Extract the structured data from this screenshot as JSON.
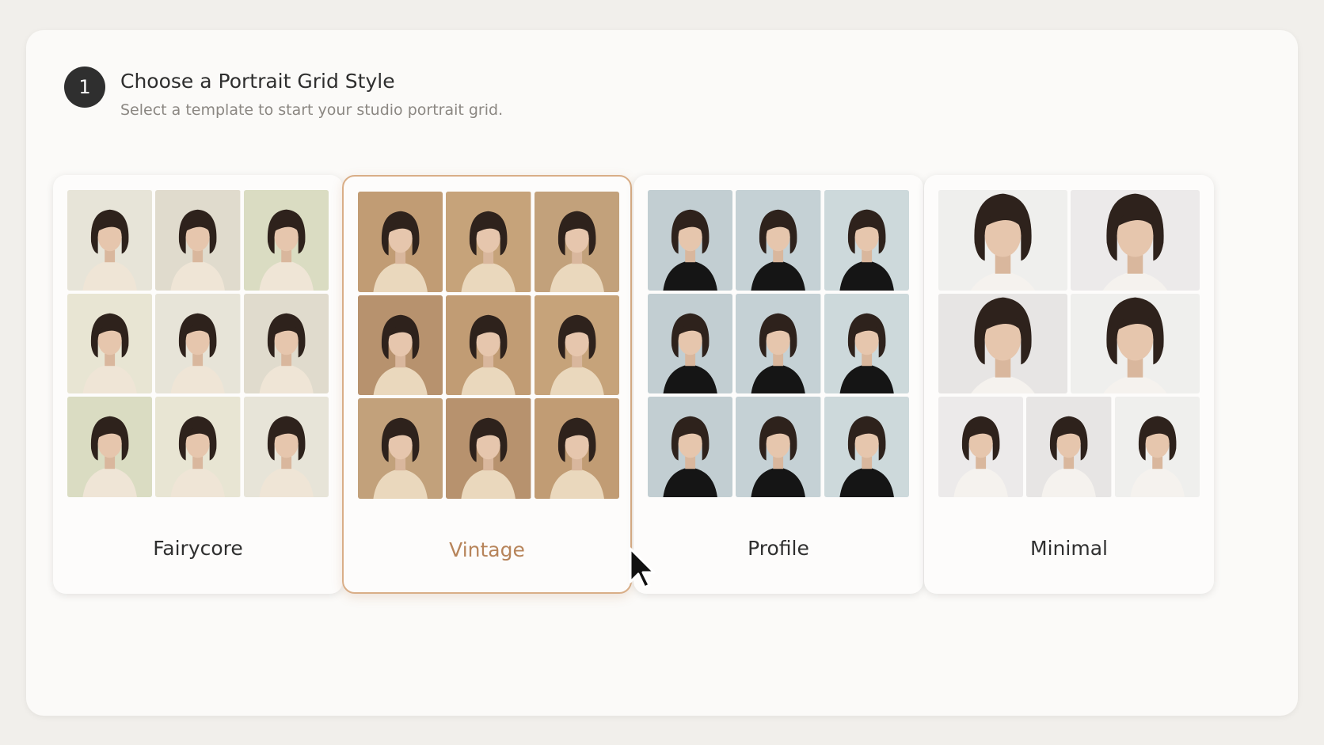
{
  "step": {
    "number": "1",
    "title": "Choose a Portrait Grid Style",
    "subtitle": "Select a template to start your studio portrait grid."
  },
  "templates": [
    {
      "label": "Fairycore",
      "selected": false,
      "layout": "3x3",
      "background_colors": [
        "#dfe7cf",
        "#f2dfe3",
        "#c9d7b1",
        "#efe3d8"
      ],
      "outfit_color": "#efe5d6",
      "image_alt": "portrait photo of woman in floral garden"
    },
    {
      "label": "Vintage",
      "selected": true,
      "layout": "3x3",
      "background_colors": [
        "#c8a57e",
        "#b99269",
        "#d8b991",
        "#a98461"
      ],
      "outfit_color": "#ead8bd",
      "image_alt": "warm sepia studio portrait photo"
    },
    {
      "label": "Profile",
      "selected": false,
      "layout": "3x3",
      "background_colors": [
        "#c8d4d8",
        "#bac8cd",
        "#d2dcdf"
      ],
      "outfit_color": "#151515",
      "image_alt": "studio portrait photo in black turtleneck"
    },
    {
      "label": "Minimal",
      "selected": false,
      "layout": "2-2-3",
      "background_colors": [
        "#ecebea",
        "#f4f3f2",
        "#e3e1df"
      ],
      "outfit_color": "#f5f2ee",
      "image_alt": "bright minimal portrait photo"
    }
  ],
  "colors": {
    "accent": "#d9ae87",
    "accent_text": "#b7845a",
    "badge": "#2f2f2f"
  },
  "cursor": "arrow-pointer-icon"
}
